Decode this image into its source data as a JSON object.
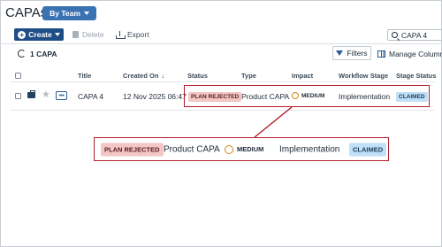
{
  "header": {
    "title": "CAPAs",
    "view_selector": "By Team"
  },
  "toolbar": {
    "create_label": "Create",
    "delete_label": "Delete",
    "export_label": "Export",
    "search_value": "CAPA 4"
  },
  "list": {
    "count_label": "1 CAPA",
    "filters_label": "Filters",
    "manage_columns_label": "Manage Columns"
  },
  "table": {
    "columns": [
      "Title",
      "Created On",
      "Status",
      "Type",
      "Impact",
      "Workflow Stage",
      "Stage Status"
    ],
    "sort_indicator": "↓",
    "rows": [
      {
        "title": "CAPA 4",
        "created_on": "12 Nov 2025 06:47",
        "status": "PLAN REJECTED",
        "type": "Product CAPA",
        "impact": "MEDIUM",
        "workflow_stage": "Implementation",
        "stage_status": "CLAIMED"
      }
    ]
  },
  "zoom_callout": {
    "status": "PLAN REJECTED",
    "type": "Product CAPA",
    "impact": "MEDIUM",
    "workflow_stage": "Implementation",
    "stage_status": "CLAIMED"
  },
  "colors": {
    "primary": "#1f4e86",
    "accent": "#3a73b4",
    "highlight_border": "#b41c2b",
    "status_rejected_bg": "#f3c7c6",
    "stage_claimed_bg": "#bfe0f7",
    "impact_medium": "#d08a1a"
  },
  "icons": [
    "caret-down-icon",
    "plus-circle-icon",
    "trash-icon",
    "export-icon",
    "search-icon",
    "refresh-icon",
    "funnel-icon",
    "columns-icon",
    "briefcase-icon",
    "star-icon",
    "more-icon"
  ]
}
